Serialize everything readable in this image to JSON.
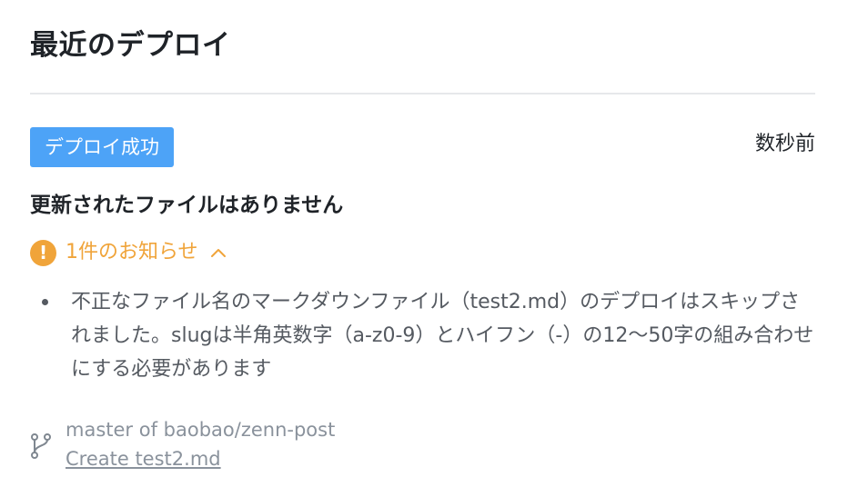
{
  "header": {
    "title": "最近のデプロイ"
  },
  "deploy": {
    "status_badge": "デプロイ成功",
    "time_ago": "数秒前",
    "summary": "更新されたファイルはありません",
    "notice_toggle_label": "1件のお知らせ",
    "notice_icon": "exclamation-icon",
    "notice_items": [
      "不正なファイル名のマークダウンファイル（test2.md）のデプロイはスキップされました。slugは半角英数字（a-z0-9）とハイフン（-）の12〜50字の組み合わせにする必要があります"
    ],
    "branch_text": "master of baobao/zenn-post",
    "commit_link": "Create test2.md"
  },
  "colors": {
    "badge_background": "#4da3f7",
    "warning": "#f0a43a",
    "muted_text": "#8a929c",
    "body_text": "#555a61",
    "title_text": "#1f2328",
    "divider": "#e6e8eb"
  },
  "icons": {
    "warning": "exclamation-circle-icon",
    "chevron": "chevron-up-icon",
    "branch": "git-branch-icon"
  }
}
